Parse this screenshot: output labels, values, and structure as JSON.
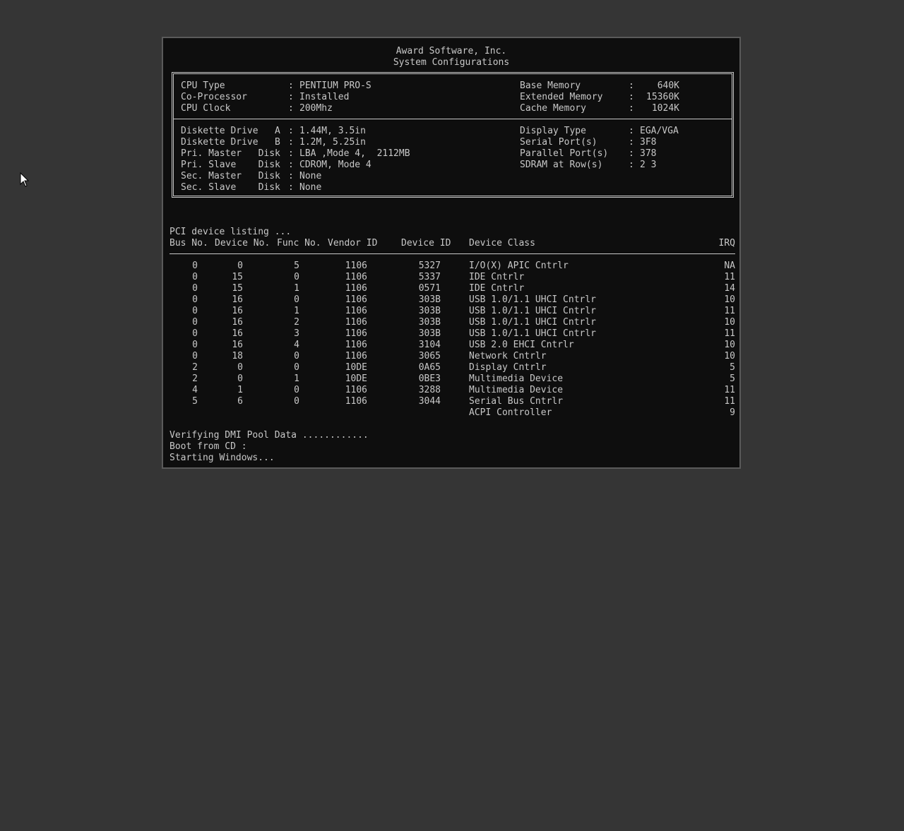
{
  "header": {
    "vendor": "Award Software, Inc.",
    "title": "System Configurations"
  },
  "sysinfo": {
    "left_top": [
      {
        "label": "CPU Type",
        "value": "PENTIUM PRO-S"
      },
      {
        "label": "Co-Processor",
        "value": "Installed"
      },
      {
        "label": "CPU Clock",
        "value": "200Mhz"
      }
    ],
    "right_top": [
      {
        "label": "Base Memory",
        "value": "640K"
      },
      {
        "label": "Extended Memory",
        "value": "15360K"
      },
      {
        "label": "Cache Memory",
        "value": "1024K"
      }
    ],
    "left_bottom": [
      {
        "label": "Diskette Drive   A",
        "value": "1.44M, 3.5in"
      },
      {
        "label": "Diskette Drive   B",
        "value": "1.2M, 5.25in"
      },
      {
        "label": "Pri. Master   Disk",
        "value": "LBA ,Mode 4,  2112MB"
      },
      {
        "label": "Pri. Slave    Disk",
        "value": "CDROM, Mode 4"
      },
      {
        "label": "Sec. Master   Disk",
        "value": "None"
      },
      {
        "label": "Sec. Slave    Disk",
        "value": "None"
      }
    ],
    "right_bottom": [
      {
        "label": "Display Type",
        "value": "EGA/VGA"
      },
      {
        "label": "Serial Port(s)",
        "value": "3F8"
      },
      {
        "label": "Parallel Port(s)",
        "value": "378"
      },
      {
        "label": "SDRAM at Row(s)",
        "value": "2 3"
      }
    ]
  },
  "pci": {
    "title": "PCI device listing ...",
    "headers": {
      "bus": "Bus No.",
      "device": "Device No.",
      "func": "Func No.",
      "vendor": "Vendor ID",
      "device_id": "Device ID",
      "class": "Device Class",
      "irq": "IRQ"
    },
    "rows": [
      {
        "bus": "0",
        "device": "0",
        "func": "5",
        "vendor": "1106",
        "device_id": "5327",
        "class": "I/O(X) APIC Cntrlr",
        "irq": "NA"
      },
      {
        "bus": "0",
        "device": "15",
        "func": "0",
        "vendor": "1106",
        "device_id": "5337",
        "class": "IDE Cntrlr",
        "irq": "11"
      },
      {
        "bus": "0",
        "device": "15",
        "func": "1",
        "vendor": "1106",
        "device_id": "0571",
        "class": "IDE Cntrlr",
        "irq": "14"
      },
      {
        "bus": "0",
        "device": "16",
        "func": "0",
        "vendor": "1106",
        "device_id": "303B",
        "class": "USB 1.0/1.1 UHCI Cntrlr",
        "irq": "10"
      },
      {
        "bus": "0",
        "device": "16",
        "func": "1",
        "vendor": "1106",
        "device_id": "303B",
        "class": "USB 1.0/1.1 UHCI Cntrlr",
        "irq": "11"
      },
      {
        "bus": "0",
        "device": "16",
        "func": "2",
        "vendor": "1106",
        "device_id": "303B",
        "class": "USB 1.0/1.1 UHCI Cntrlr",
        "irq": "10"
      },
      {
        "bus": "0",
        "device": "16",
        "func": "3",
        "vendor": "1106",
        "device_id": "303B",
        "class": "USB 1.0/1.1 UHCI Cntrlr",
        "irq": "11"
      },
      {
        "bus": "0",
        "device": "16",
        "func": "4",
        "vendor": "1106",
        "device_id": "3104",
        "class": "USB 2.0 EHCI Cntrlr",
        "irq": "10"
      },
      {
        "bus": "0",
        "device": "18",
        "func": "0",
        "vendor": "1106",
        "device_id": "3065",
        "class": "Network Cntrlr",
        "irq": "10"
      },
      {
        "bus": "2",
        "device": "0",
        "func": "0",
        "vendor": "10DE",
        "device_id": "0A65",
        "class": "Display Cntrlr",
        "irq": "5"
      },
      {
        "bus": "2",
        "device": "0",
        "func": "1",
        "vendor": "10DE",
        "device_id": "0BE3",
        "class": "Multimedia Device",
        "irq": "5"
      },
      {
        "bus": "4",
        "device": "1",
        "func": "0",
        "vendor": "1106",
        "device_id": "3288",
        "class": "Multimedia Device",
        "irq": "11"
      },
      {
        "bus": "5",
        "device": "6",
        "func": "0",
        "vendor": "1106",
        "device_id": "3044",
        "class": "Serial Bus Cntrlr",
        "irq": "11"
      },
      {
        "bus": "",
        "device": "",
        "func": "",
        "vendor": "",
        "device_id": "",
        "class": "ACPI Controller",
        "irq": "9"
      }
    ]
  },
  "messages": [
    "Verifying DMI Pool Data ............",
    "Boot from CD :",
    "Starting Windows..."
  ],
  "colors": {
    "background": "#353535",
    "screen": "#0e0e0e",
    "text": "#c8c8c8"
  },
  "icons": {
    "cursor": "mouse-pointer-icon"
  }
}
